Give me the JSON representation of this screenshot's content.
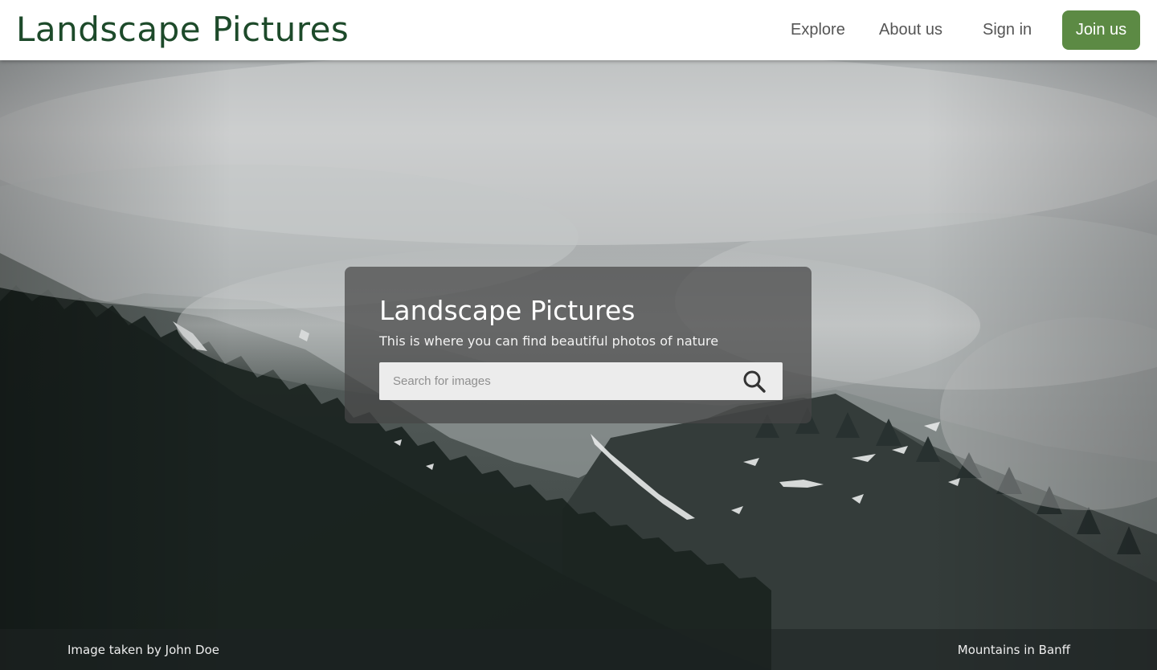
{
  "header": {
    "logo_text": "Landscape Pictures",
    "nav": {
      "explore": "Explore",
      "about": "About us",
      "signin": "Sign in"
    },
    "join_label": "Join us"
  },
  "hero": {
    "title": "Landscape Pictures",
    "subtitle": "This is where you can find beautiful photos of nature",
    "search": {
      "placeholder": "Search for images",
      "value": ""
    }
  },
  "caption": {
    "credit": "Image taken by John Doe",
    "location": "Mountains in Banff"
  },
  "colors": {
    "brand_green": "#1d4a2a",
    "button_green": "#5c8a44"
  },
  "icons": {
    "search": "search-icon"
  }
}
